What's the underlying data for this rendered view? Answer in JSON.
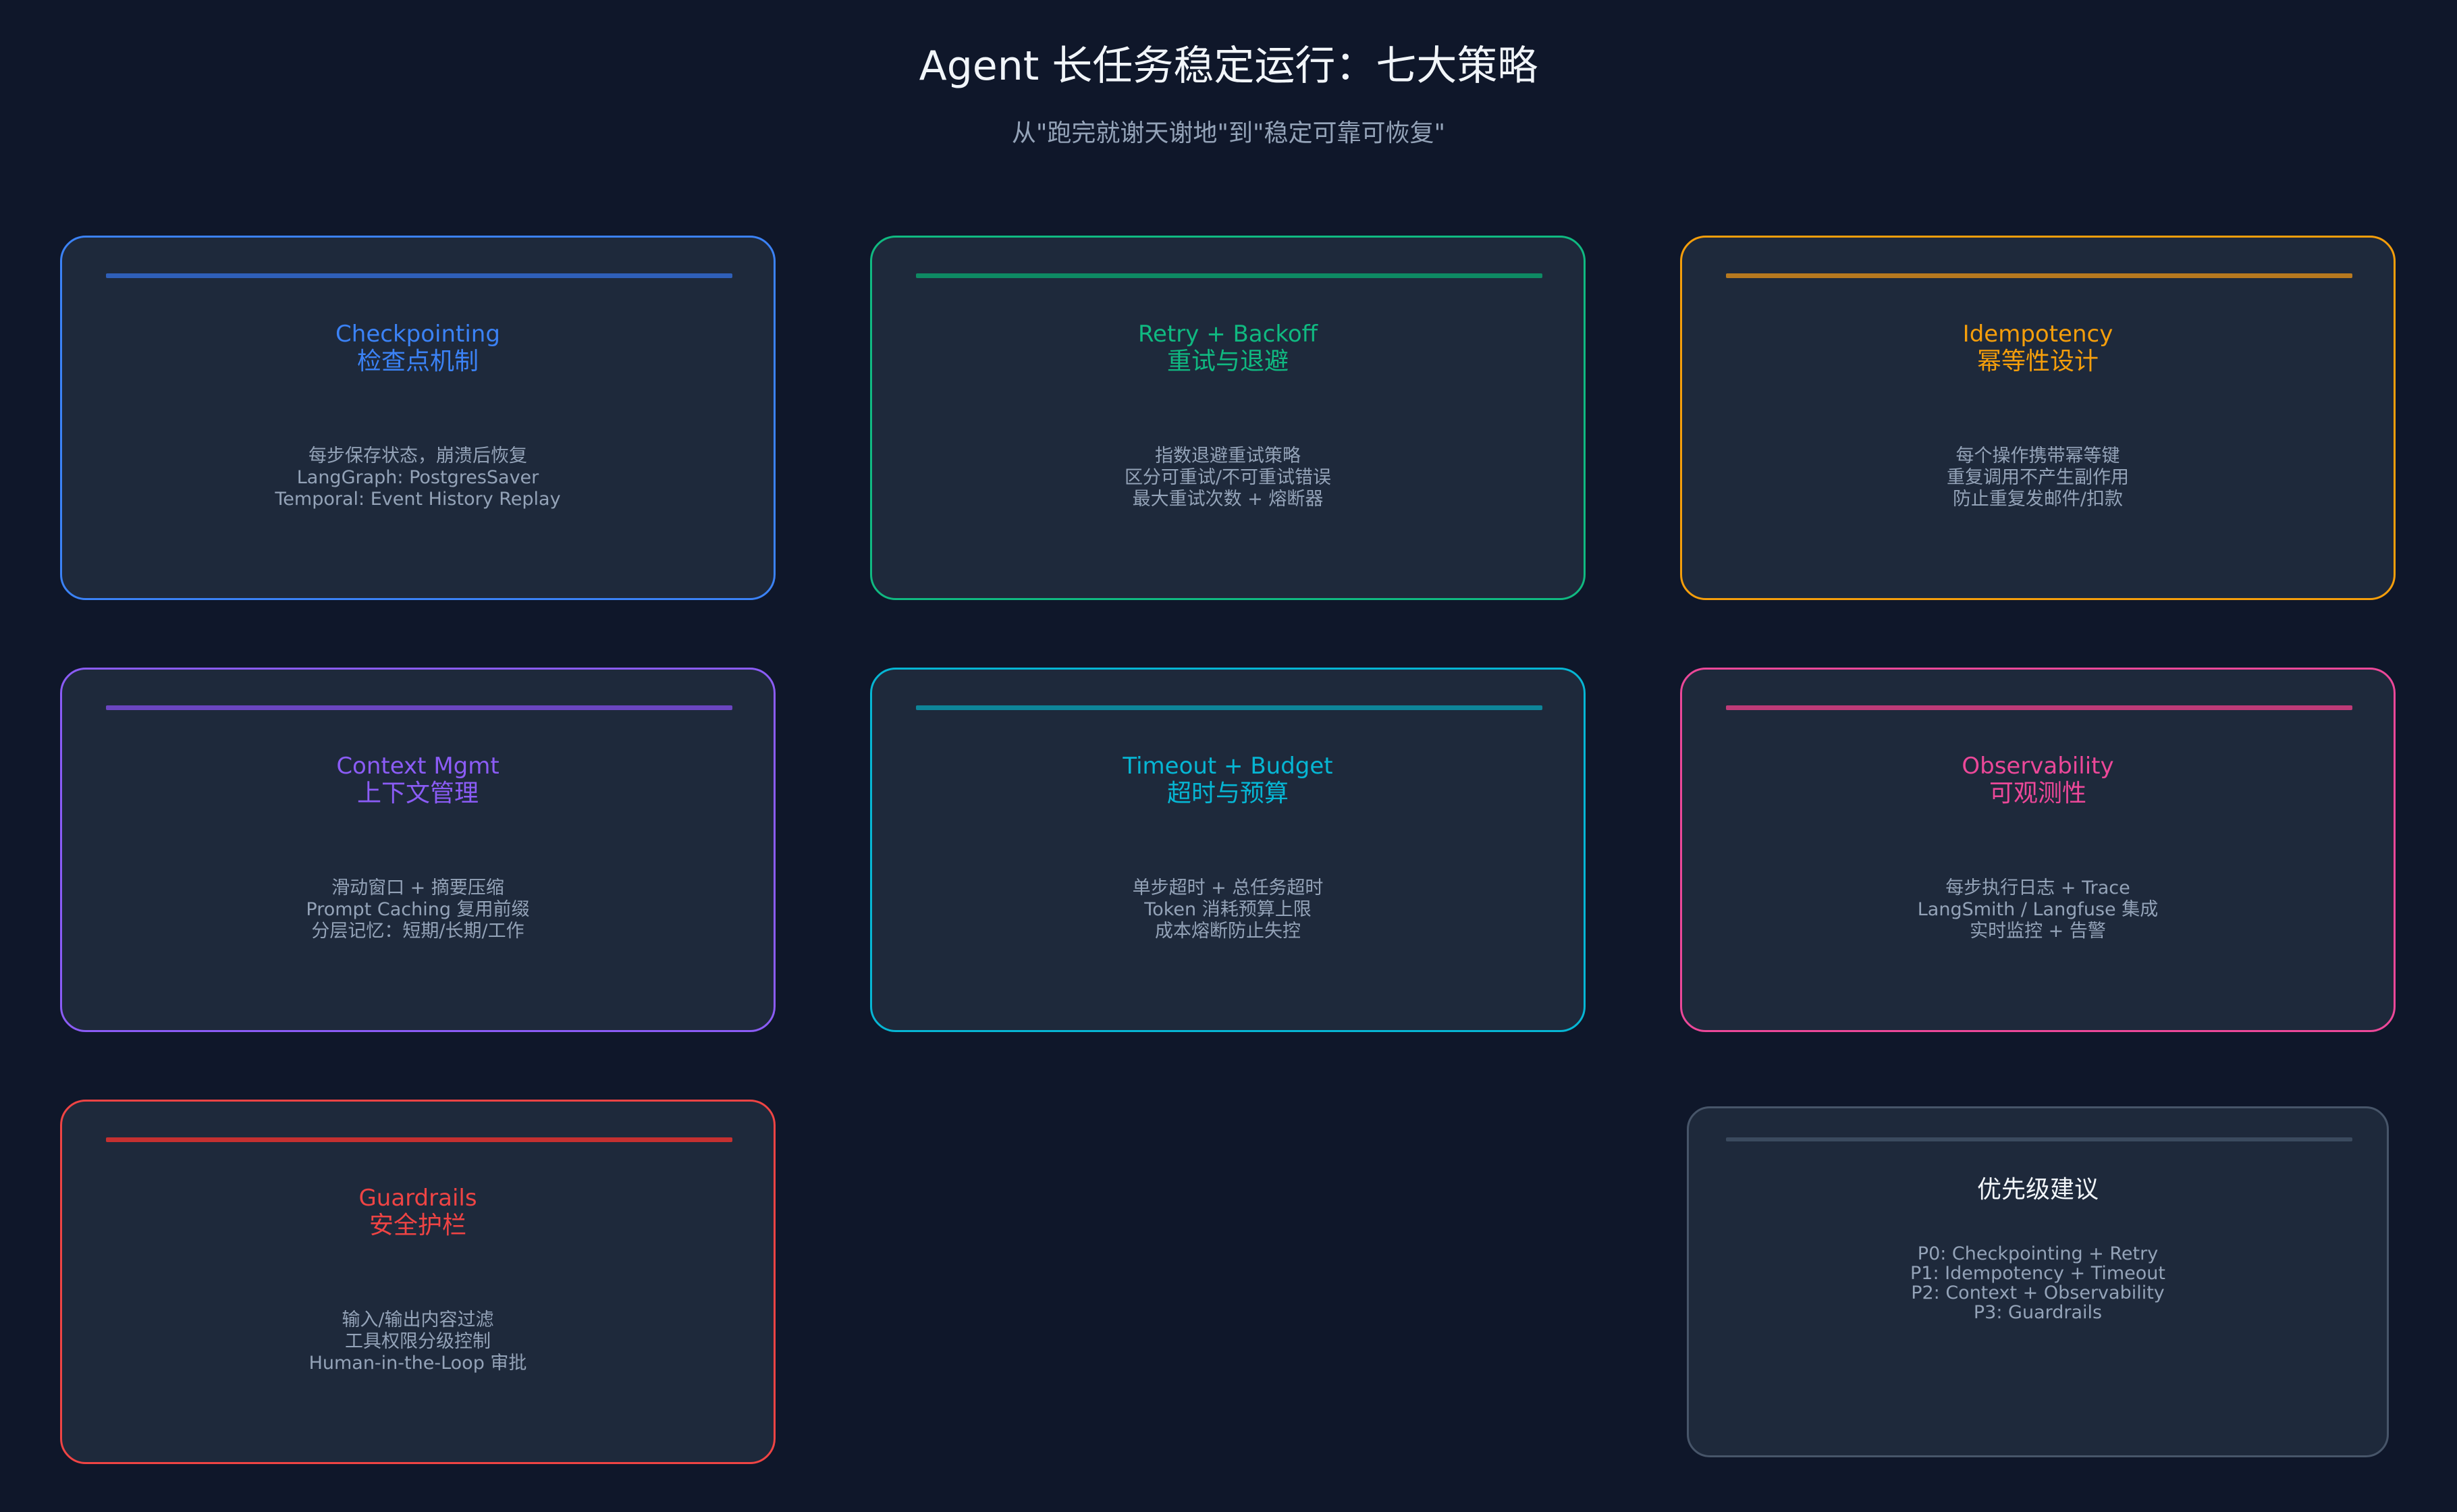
{
  "header": {
    "title": "Agent 长任务稳定运行：七大策略",
    "subtitle": "从\"跑完就谢天谢地\"到\"稳定可靠可恢复\""
  },
  "cards": [
    {
      "name_en": "Checkpointing",
      "name_zh": "检查点机制",
      "lines": [
        "每步保存状态，崩溃后恢复",
        "LangGraph: PostgresSaver",
        "Temporal: Event History Replay"
      ],
      "color": "#3b82f6"
    },
    {
      "name_en": "Retry + Backoff",
      "name_zh": "重试与退避",
      "lines": [
        "指数退避重试策略",
        "区分可重试/不可重试错误",
        "最大重试次数 + 熔断器"
      ],
      "color": "#10b981"
    },
    {
      "name_en": "Idempotency",
      "name_zh": "幂等性设计",
      "lines": [
        "每个操作携带幂等键",
        "重复调用不产生副作用",
        "防止重复发邮件/扣款"
      ],
      "color": "#f59e0b"
    },
    {
      "name_en": "Context Mgmt",
      "name_zh": "上下文管理",
      "lines": [
        "滑动窗口 + 摘要压缩",
        "Prompt Caching 复用前缀",
        "分层记忆：短期/长期/工作"
      ],
      "color": "#8b5cf6"
    },
    {
      "name_en": "Timeout + Budget",
      "name_zh": "超时与预算",
      "lines": [
        "单步超时 + 总任务超时",
        "Token 消耗预算上限",
        "成本熔断防止失控"
      ],
      "color": "#06b6d4"
    },
    {
      "name_en": "Observability",
      "name_zh": "可观测性",
      "lines": [
        "每步执行日志 + Trace",
        "LangSmith / Langfuse 集成",
        "实时监控 + 告警"
      ],
      "color": "#ec4899"
    },
    {
      "name_en": "Guardrails",
      "name_zh": "安全护栏",
      "lines": [
        "输入/输出内容过滤",
        "工具权限分级控制",
        "Human-in-the-Loop 审批"
      ],
      "color": "#ef4444"
    }
  ],
  "priority": {
    "title": "优先级建议",
    "lines": [
      "P0: Checkpointing + Retry",
      "P1: Idempotency + Timeout",
      "P2: Context + Observability",
      "P3: Guardrails"
    ]
  }
}
